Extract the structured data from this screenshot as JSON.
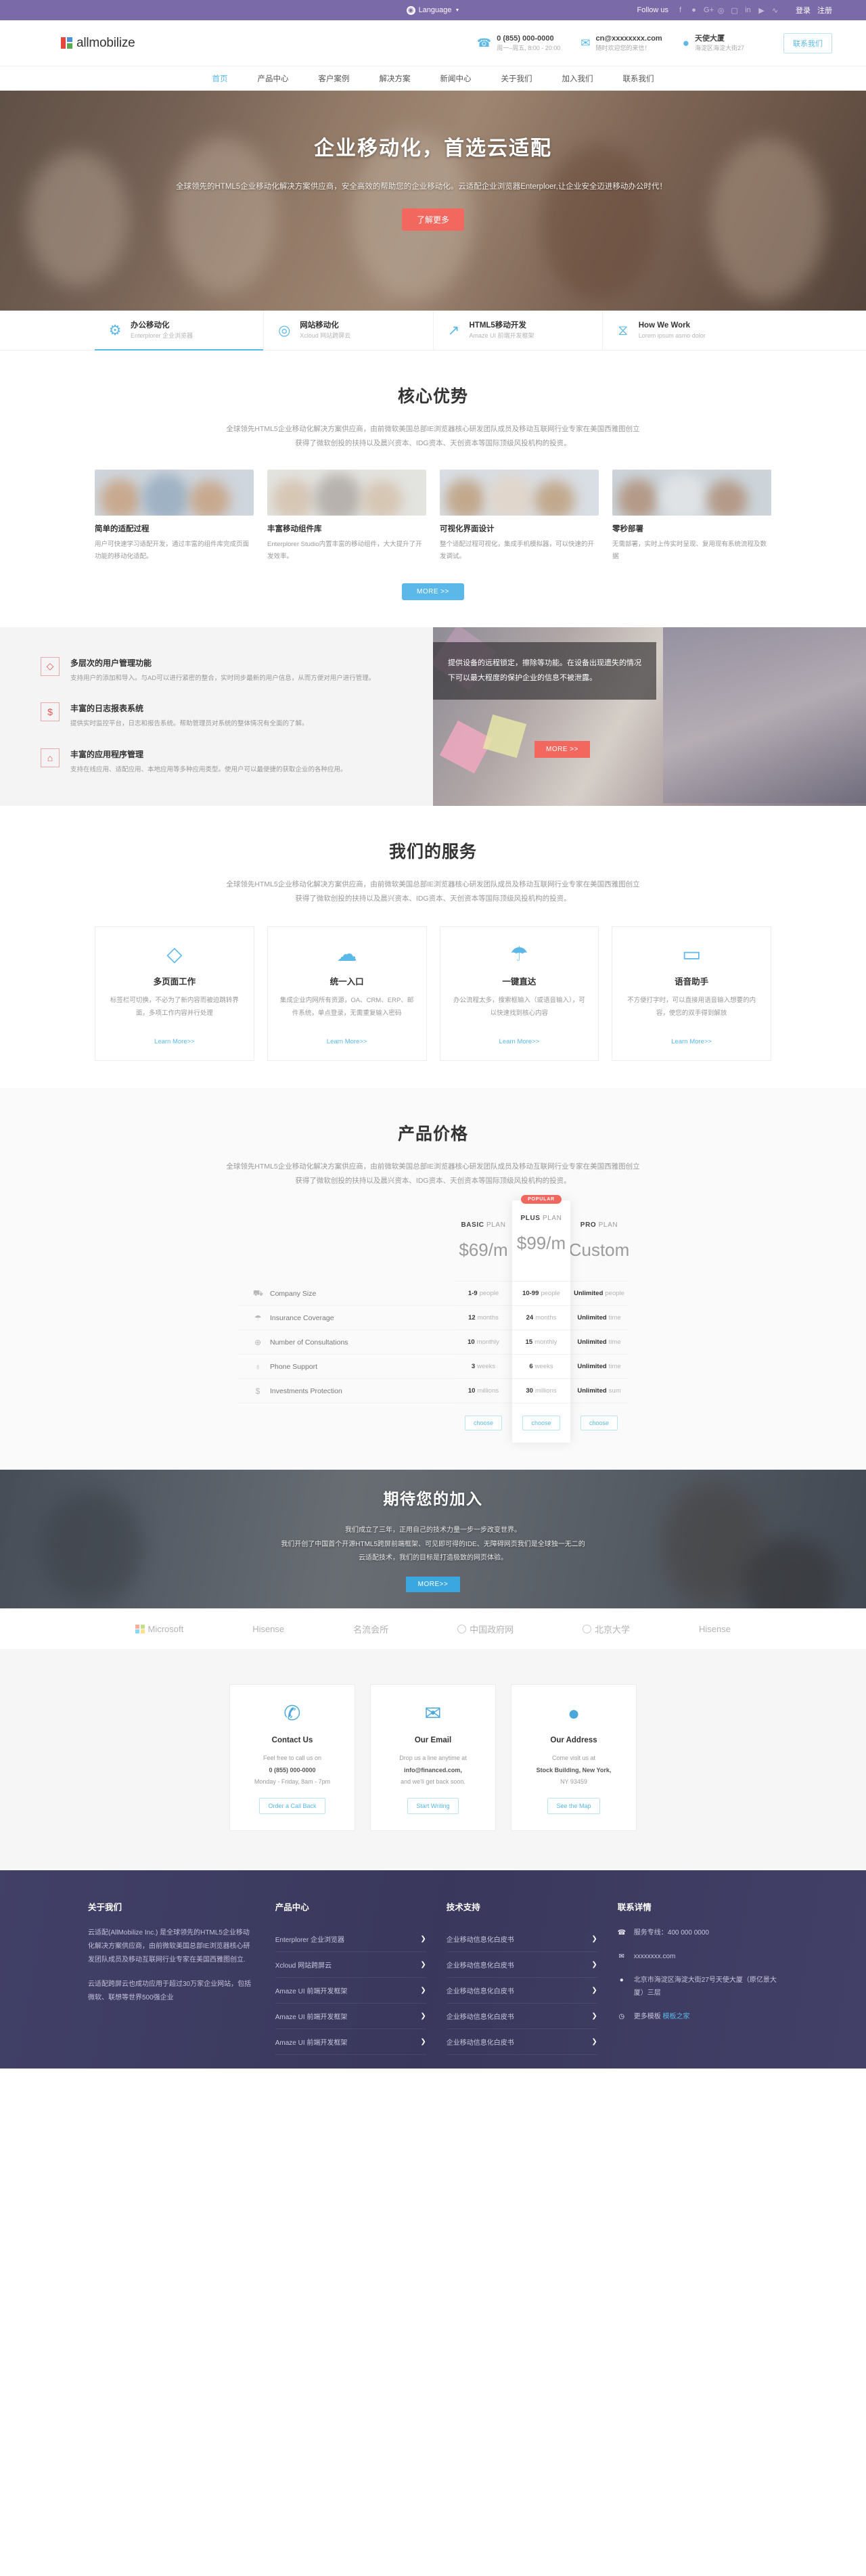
{
  "topbar": {
    "language_label": "Language",
    "globe_icon": "globe-icon",
    "follow_label": "Follow us",
    "socials": [
      "f",
      "🐦",
      "G+",
      "◉",
      "◎",
      "in",
      "▶",
      "≫"
    ],
    "login": "登录",
    "register": "注册"
  },
  "header": {
    "brand": "allmobilize",
    "phone": {
      "icon": "phone-icon",
      "title": "0 (855) 000-0000",
      "sub": "周一–周五, 8:00 - 20:00"
    },
    "email": {
      "icon": "envelope-icon",
      "title": "cn@xxxxxxxx.com",
      "sub": "随时欢迎您的来信！"
    },
    "address": {
      "icon": "map-pin-icon",
      "title": "天使大厦",
      "sub": "海淀区海淀大街27"
    },
    "contact_button": "联系我们"
  },
  "nav": {
    "items": [
      {
        "label": "首页",
        "active": true
      },
      {
        "label": "产品中心",
        "active": false
      },
      {
        "label": "客户案例",
        "active": false
      },
      {
        "label": "解决方案",
        "active": false
      },
      {
        "label": "新闻中心",
        "active": false
      },
      {
        "label": "关于我们",
        "active": false
      },
      {
        "label": "加入我们",
        "active": false
      },
      {
        "label": "联系我们",
        "active": false
      }
    ]
  },
  "hero": {
    "title": "企业移动化，首选云适配",
    "desc": "全球领先的HTML5企业移动化解决方案供应商，安全高效的帮助您的企业移动化。云适配企业浏览器Enterploer,让企业安全迈进移动办公时代！",
    "button": "了解更多"
  },
  "tabs": [
    {
      "icon": "gear-icon",
      "title": "办公移动化",
      "sub": "Enterplorer 企业浏览器",
      "active": true
    },
    {
      "icon": "lightbulb-icon",
      "title": "网站移动化",
      "sub": "Xcloud 网站跨屏云",
      "active": false
    },
    {
      "icon": "chart-icon",
      "title": "HTML5移动开发",
      "sub": "Amaze UI 前端开发框架",
      "active": false
    },
    {
      "icon": "hourglass-icon",
      "title": "How We Work",
      "sub": "Lorem ipsum asmo dolor",
      "active": false
    }
  ],
  "advantage": {
    "title": "核心优势",
    "desc_line1": "全球领先HTML5企业移动化解决方案供应商，由前微软美国总部IE浏览器核心研发团队成员及移动互联网行业专家在美国西雅图创立",
    "desc_line2": "获得了微软创投的扶持以及晨兴资本、IDG资本、天创资本等国际顶级风投机构的投资。",
    "cards": [
      {
        "title": "简单的适配过程",
        "text": "用户可快速学习适配开发，通过丰富的组件库完成页面功能的移动化适配。"
      },
      {
        "title": "丰富移动组件库",
        "text": "Enterplorer Studio内置丰富的移动组件，大大提升了开发效率。"
      },
      {
        "title": "可视化界面设计",
        "text": "整个适配过程可视化，集成手机模拟器，可以快速的开发调试。"
      },
      {
        "title": "零秒部署",
        "text": "无需部署，实时上传实时呈现、复用现有系统流程及数据"
      }
    ],
    "more": "MORE >>"
  },
  "band": {
    "features": [
      {
        "icon": "diamond-icon",
        "title": "多层次的用户管理功能",
        "text": "支持用户的添加和导入。与AD可以进行紧密的整合，实时同步最新的用户信息，从而方便对用户进行管理。"
      },
      {
        "icon": "dollar-icon",
        "title": "丰富的日志报表系统",
        "text": "提供实时监控平台，日志和报告系统。帮助管理员对系统的整体情况有全面的了解。"
      },
      {
        "icon": "bank-icon",
        "title": "丰富的应用程序管理",
        "text": "支持在线应用、适配应用、本地应用等多种应用类型。使用户可以最便捷的获取企业的各种应用。"
      }
    ],
    "overlay_text": "提供设备的远程锁定，擦除等功能。在设备出现遗失的情况下可以最大程度的保护企业的信息不被泄露。",
    "overlay_button": "MORE >>"
  },
  "services": {
    "title": "我们的服务",
    "desc_line1": "全球领先HTML5企业移动化解决方案供应商，由前微软美国总部IE浏览器核心研发团队成员及移动互联网行业专家在美国西雅图创立",
    "desc_line2": "获得了微软创投的扶持以及晨兴资本、IDG资本、天创资本等国际顶级风投机构的投资。",
    "cards": [
      {
        "icon": "diamond-icon",
        "title": "多页面工作",
        "text": "标签栏可切换，不必为了新内容而被迫跳转界面，多项工作内容并行处理",
        "link": "Learn More>>"
      },
      {
        "icon": "user-cloud-icon",
        "title": "统一入口",
        "text": "集成企业内网所有资源，OA、CRM、ERP、邮件系统，单点登录，无需重复输入密码",
        "link": "Learn More>>"
      },
      {
        "icon": "umbrella-icon",
        "title": "一键直达",
        "text": "办公流程太多，搜索框输入（或语音输入），可以快速找到核心内容",
        "link": "Learn More>>"
      },
      {
        "icon": "briefcase-icon",
        "title": "语音助手",
        "text": "不方便打字时，可以直接用语音输入想要的内容，使您的双手得到解放",
        "link": "Learn More>>"
      }
    ]
  },
  "pricing": {
    "title": "产品价格",
    "desc_line1": "全球领先HTML5企业移动化解决方案供应商，由前微软美国总部IE浏览器核心研发团队成员及移动互联网行业专家在美国西雅图创立",
    "desc_line2": "获得了微软创投的扶持以及晨兴资本、IDG资本、天创资本等国际顶级风投机构的投资。",
    "features": [
      {
        "icon": "people-icon",
        "label": "Company Size"
      },
      {
        "icon": "umbrella-icon",
        "label": "Insurance Coverage"
      },
      {
        "icon": "lifebuoy-icon",
        "label": "Number of Consultations"
      },
      {
        "icon": "mic-icon",
        "label": "Phone Support"
      },
      {
        "icon": "dollar-icon",
        "label": "Investments Protection"
      }
    ],
    "plans": [
      {
        "name_bold": "BASIC",
        "name_rest": " PLAN",
        "price": "$69/m",
        "popular": false,
        "badge": "",
        "values": [
          {
            "b": "1-9",
            "t": " people"
          },
          {
            "b": "12",
            "t": "months"
          },
          {
            "b": "10",
            "t": " monthly"
          },
          {
            "b": "3",
            "t": " weeks"
          },
          {
            "b": "10",
            "t": " millions"
          }
        ],
        "choose": "choose"
      },
      {
        "name_bold": "PLUS",
        "name_rest": " PLAN",
        "price": "$99/m",
        "popular": true,
        "badge": "POPULAR",
        "values": [
          {
            "b": "10-99",
            "t": " people"
          },
          {
            "b": "24",
            "t": "months"
          },
          {
            "b": "15",
            "t": " monthly"
          },
          {
            "b": "6",
            "t": " weeks"
          },
          {
            "b": "30",
            "t": " millions"
          }
        ],
        "choose": "choose"
      },
      {
        "name_bold": "PRO",
        "name_rest": " PLAN",
        "price": "Custom",
        "popular": false,
        "badge": "",
        "values": [
          {
            "b": "Unlimited",
            "t": " people"
          },
          {
            "b": "Unlimited",
            "t": " time"
          },
          {
            "b": "Unlimited",
            "t": " time"
          },
          {
            "b": "Unlimited",
            "t": " time"
          },
          {
            "b": "Unlimited",
            "t": " sum"
          }
        ],
        "choose": "choose"
      }
    ]
  },
  "join": {
    "title": "期待您的加入",
    "line1": "我们成立了三年，正用自己的技术力量一步一步改变世界。",
    "line2": "我们开创了中国首个开源HTML5跨屏前端框架、可见即可得的IDE、无障碍网页我们是全球独一无二的",
    "line3": "云适配技术，我们的目标是打造极致的网页体验。",
    "button": "MORE>>"
  },
  "partners": [
    {
      "name": "Microsoft",
      "icon": "microsoft-squares-icon"
    },
    {
      "name": "Hisense",
      "icon": "text-logo"
    },
    {
      "name": "名流会所",
      "icon": "text-logo"
    },
    {
      "name": "中国政府网",
      "icon": "seal-icon"
    },
    {
      "name": "北京大学",
      "icon": "seal-icon"
    },
    {
      "name": "Hisense",
      "icon": "text-logo"
    }
  ],
  "contact_cards": [
    {
      "icon": "phone-icon",
      "title": "Contact Us",
      "l1": "Feel free to call us on",
      "l2": "0 (855) 000-0000",
      "l3": "Monday - Friday, 8am - 7pm",
      "button": "Order a Call Back"
    },
    {
      "icon": "envelope-icon",
      "title": "Our Email",
      "l1": "Drop us a line anytime at",
      "l2": "info@financed.com,",
      "l3": "and we'll get back soon.",
      "button": "Start Writing"
    },
    {
      "icon": "map-pin-icon",
      "title": "Our Address",
      "l1": "Come visit us at",
      "l2": "Stock Building, New York,",
      "l3": "NY 93459",
      "button": "See the Map"
    }
  ],
  "footer": {
    "about": {
      "title": "关于我们",
      "p1": "云适配(AllMobilize Inc.) 是全球领先的HTML5企业移动化解决方案供应商，由前微软美国总部IE浏览器核心研发团队成员及移动互联网行业专家在美国西雅图创立.",
      "p2": "云适配跨屏云也成功应用于超过30万家企业网站，包括微软、联想等世界500强企业"
    },
    "products": {
      "title": "产品中心",
      "links": [
        "Enterplorer 企业浏览器",
        "Xcloud 网站跨屏云",
        "Amaze UI 前端开发框架",
        "Amaze UI 前端开发框架",
        "Amaze UI 前端开发框架"
      ]
    },
    "tech": {
      "title": "技术支持",
      "links": [
        "企业移动信息化白皮书",
        "企业移动信息化白皮书",
        "企业移动信息化白皮书",
        "企业移动信息化白皮书",
        "企业移动信息化白皮书"
      ]
    },
    "contact": {
      "title": "联系详情",
      "phone": "服务专线：400 000 0000",
      "email": "xxxxxxxx.com",
      "address": "北京市海淀区海淀大街27号天使大厦（原亿景大厦）三层",
      "more_label": "更多模板",
      "more_link": "模板之家"
    }
  },
  "colors": {
    "purple": "#7b6aa8",
    "blue": "#5bb8e8",
    "red": "#f2685f",
    "footer_bg": "#3b3a5e"
  }
}
